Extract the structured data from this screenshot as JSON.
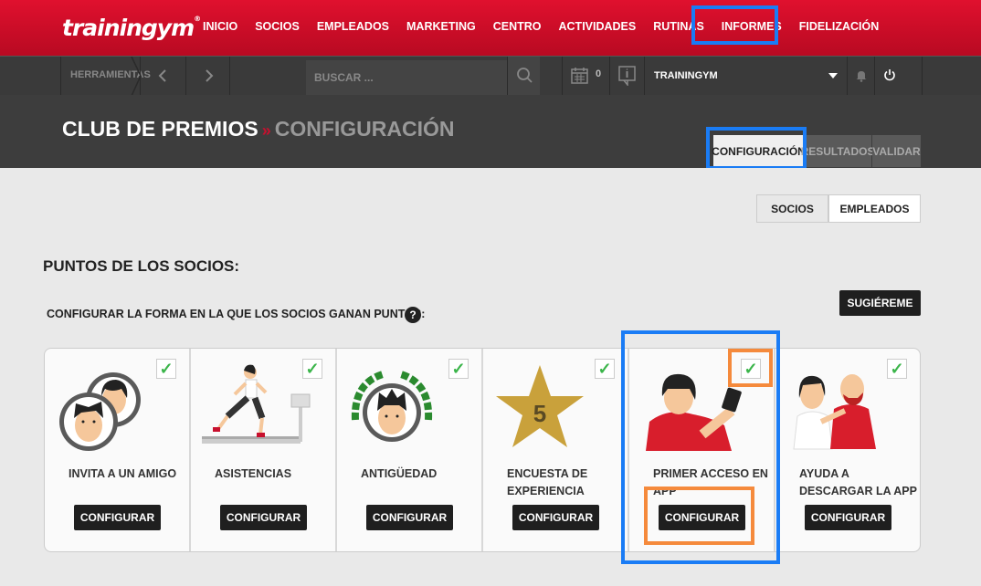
{
  "brand": {
    "logo": "trainingym",
    "trademark": "®"
  },
  "nav": {
    "items": [
      "INICIO",
      "SOCIOS",
      "EMPLEADOS",
      "MARKETING",
      "CENTRO",
      "ACTIVIDADES",
      "RUTINAS",
      "INFORMES",
      "FIDELIZACIÓN"
    ]
  },
  "toolbar": {
    "tools_label": "HERRAMIENTAS",
    "search_placeholder": "BUSCAR ...",
    "calendar_count": "0",
    "center_name": "TRAININGYM"
  },
  "page": {
    "title": "CLUB DE PREMIOS",
    "separator": "»",
    "subtitle": "CONFIGURACIÓN"
  },
  "tabs": [
    "CONFIGURACIÓN",
    "RESULTADOS",
    "VALIDAR"
  ],
  "segments": [
    "SOCIOS",
    "EMPLEADOS"
  ],
  "section": {
    "title": "PUNTOS DE LOS SOCIOS:",
    "subtitle": "CONFIGURAR LA FORMA EN LA QUE LOS SOCIOS GANAN PUNTOS:",
    "help": "?",
    "suggest_button": "SUGIÉREME"
  },
  "cards": [
    {
      "label": "INVITA A UN AMIGO",
      "button": "CONFIGURAR",
      "checked": true
    },
    {
      "label": "ASISTENCIAS",
      "button": "CONFIGURAR",
      "checked": true
    },
    {
      "label": "ANTIGÜEDAD",
      "button": "CONFIGURAR",
      "checked": true
    },
    {
      "label": "ENCUESTA DE EXPERIENCIA",
      "button": "CONFIGURAR",
      "checked": true,
      "badge": "5"
    },
    {
      "label": "PRIMER ACCESO EN APP",
      "button": "CONFIGURAR",
      "checked": true
    },
    {
      "label": "AYUDA A DESCARGAR LA APP",
      "button": "CONFIGURAR",
      "checked": true
    }
  ],
  "check_glyph": "✓",
  "colors": {
    "brand_red": "#d10f2b",
    "highlight_blue": "#1a7cf5",
    "highlight_orange": "#f58a3c",
    "check_green": "#3bb54a"
  }
}
